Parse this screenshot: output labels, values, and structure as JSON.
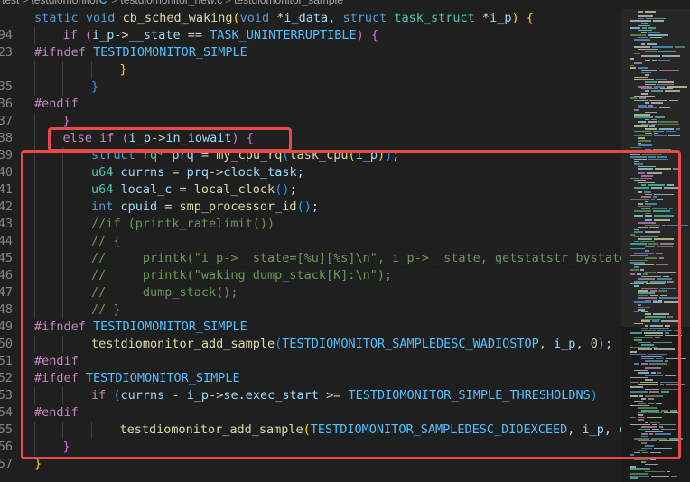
{
  "breadcrumb": {
    "parts": [
      "test",
      "testdiomonitor",
      "C",
      "testdiomonitor_new.c",
      "testdiomonitor_sample"
    ],
    "separator": ">"
  },
  "code_lines": [
    {
      "ln": "",
      "indent": 0,
      "tokens": [
        [
          "kw",
          "static"
        ],
        [
          "op",
          " "
        ],
        [
          "kw",
          "void"
        ],
        [
          "op",
          " "
        ],
        [
          "fn",
          "cb_sched_waking"
        ],
        [
          "br1",
          "("
        ],
        [
          "kw",
          "void"
        ],
        [
          "op",
          " *"
        ],
        [
          "var",
          "i_data"
        ],
        [
          "op",
          ", "
        ],
        [
          "kw",
          "struct"
        ],
        [
          "op",
          " "
        ],
        [
          "ty",
          "task_struct"
        ],
        [
          "op",
          " *"
        ],
        [
          "var",
          "i_p"
        ],
        [
          "br1",
          ")"
        ],
        [
          "op",
          " "
        ],
        [
          "br1",
          "{"
        ]
      ]
    },
    {
      "ln": "94",
      "indent": 1,
      "tokens": [
        [
          "pre",
          "if"
        ],
        [
          "op",
          " "
        ],
        [
          "br2",
          "("
        ],
        [
          "var",
          "i_p"
        ],
        [
          "op",
          "->"
        ],
        [
          "var",
          "__state"
        ],
        [
          "op",
          " == "
        ],
        [
          "mac",
          "TASK_UNINTERRUPTIBLE"
        ],
        [
          "br2",
          ")"
        ],
        [
          "op",
          " "
        ],
        [
          "br2",
          "{"
        ]
      ]
    },
    {
      "ln": "23",
      "indent": 0,
      "tokens": [
        [
          "pre",
          "#ifndef"
        ],
        [
          "op",
          " "
        ],
        [
          "mac",
          "TESTDIOMONITOR_SIMPLE"
        ]
      ]
    },
    {
      "ln": "",
      "indent": 3,
      "tokens": [
        [
          "br1",
          "}"
        ]
      ]
    },
    {
      "ln": "35",
      "indent": 2,
      "tokens": [
        [
          "br3",
          "}"
        ]
      ]
    },
    {
      "ln": "36",
      "indent": 0,
      "tokens": [
        [
          "pre",
          "#endif"
        ]
      ]
    },
    {
      "ln": "37",
      "indent": 1,
      "tokens": [
        [
          "br2",
          "}"
        ]
      ]
    },
    {
      "ln": "38",
      "indent": 1,
      "tokens": [
        [
          "pre",
          "else"
        ],
        [
          "op",
          " "
        ],
        [
          "pre",
          "if"
        ],
        [
          "op",
          " "
        ],
        [
          "br2",
          "("
        ],
        [
          "var",
          "i_p"
        ],
        [
          "op",
          "->"
        ],
        [
          "var",
          "in_iowait"
        ],
        [
          "br2",
          ")"
        ],
        [
          "op",
          " "
        ],
        [
          "br2",
          "{"
        ]
      ]
    },
    {
      "ln": "39",
      "indent": 2,
      "tokens": [
        [
          "kw",
          "struct"
        ],
        [
          "op",
          " "
        ],
        [
          "ty",
          "rq"
        ],
        [
          "op",
          "* "
        ],
        [
          "var",
          "prq"
        ],
        [
          "op",
          " = "
        ],
        [
          "fn",
          "my_cpu_rq"
        ],
        [
          "br3",
          "("
        ],
        [
          "fn",
          "task_cpu"
        ],
        [
          "br1",
          "("
        ],
        [
          "var",
          "i_p"
        ],
        [
          "br1",
          ")"
        ],
        [
          "br3",
          ")"
        ],
        [
          "op",
          ";"
        ]
      ]
    },
    {
      "ln": "40",
      "indent": 2,
      "tokens": [
        [
          "ty",
          "u64"
        ],
        [
          "op",
          " "
        ],
        [
          "var",
          "currns"
        ],
        [
          "op",
          " = "
        ],
        [
          "var",
          "prq"
        ],
        [
          "op",
          "->"
        ],
        [
          "var",
          "clock_task"
        ],
        [
          "op",
          ";"
        ]
      ]
    },
    {
      "ln": "41",
      "indent": 2,
      "tokens": [
        [
          "ty",
          "u64"
        ],
        [
          "op",
          " "
        ],
        [
          "var",
          "local_c"
        ],
        [
          "op",
          " = "
        ],
        [
          "fn",
          "local_clock"
        ],
        [
          "br3",
          "()"
        ],
        [
          "op",
          ";"
        ]
      ]
    },
    {
      "ln": "42",
      "indent": 2,
      "tokens": [
        [
          "kw",
          "int"
        ],
        [
          "op",
          " "
        ],
        [
          "var",
          "cpuid"
        ],
        [
          "op",
          " = "
        ],
        [
          "fn",
          "smp_processor_id"
        ],
        [
          "br3",
          "()"
        ],
        [
          "op",
          ";"
        ]
      ]
    },
    {
      "ln": "43",
      "indent": 2,
      "tokens": [
        [
          "cm",
          "//if (printk_ratelimit())"
        ]
      ]
    },
    {
      "ln": "44",
      "indent": 2,
      "tokens": [
        [
          "cm",
          "// {"
        ]
      ]
    },
    {
      "ln": "45",
      "indent": 2,
      "tokens": [
        [
          "cm",
          "//     printk(\"i_p->__state=[%u][%s]\\n\", i_p->__state, getstatstr_bystate(i_p->__state));"
        ]
      ]
    },
    {
      "ln": "46",
      "indent": 2,
      "tokens": [
        [
          "cm",
          "//     printk(\"waking dump_stack[K]:\\n\");"
        ]
      ]
    },
    {
      "ln": "47",
      "indent": 2,
      "tokens": [
        [
          "cm",
          "//     dump_stack();"
        ]
      ]
    },
    {
      "ln": "48",
      "indent": 2,
      "tokens": [
        [
          "cm",
          "// }"
        ]
      ]
    },
    {
      "ln": "49",
      "indent": 0,
      "tokens": [
        [
          "pre",
          "#ifndef"
        ],
        [
          "op",
          " "
        ],
        [
          "mac",
          "TESTDIOMONITOR_SIMPLE"
        ]
      ]
    },
    {
      "ln": "50",
      "indent": 2,
      "tokens": [
        [
          "fn",
          "testdiomonitor_add_sample"
        ],
        [
          "br3",
          "("
        ],
        [
          "mac",
          "TESTDIOMONITOR_SAMPLEDESC_WADIOSTOP"
        ],
        [
          "op",
          ", "
        ],
        [
          "var",
          "i_p"
        ],
        [
          "op",
          ", "
        ],
        [
          "num",
          "0"
        ],
        [
          "br3",
          ")"
        ],
        [
          "op",
          ";"
        ]
      ]
    },
    {
      "ln": "51",
      "indent": 0,
      "tokens": [
        [
          "pre",
          "#endif"
        ]
      ]
    },
    {
      "ln": "52",
      "indent": 0,
      "tokens": [
        [
          "pre",
          "#ifdef"
        ],
        [
          "op",
          " "
        ],
        [
          "mac",
          "TESTDIOMONITOR_SIMPLE"
        ]
      ]
    },
    {
      "ln": "53",
      "indent": 2,
      "tokens": [
        [
          "pre",
          "if"
        ],
        [
          "op",
          " "
        ],
        [
          "br3",
          "("
        ],
        [
          "var",
          "currns"
        ],
        [
          "op",
          " - "
        ],
        [
          "var",
          "i_p"
        ],
        [
          "op",
          "->"
        ],
        [
          "var",
          "se"
        ],
        [
          "op",
          "."
        ],
        [
          "var",
          "exec_start"
        ],
        [
          "op",
          " >= "
        ],
        [
          "mac",
          "TESTDIOMONITOR_SIMPLE_THRESHOLDNS"
        ],
        [
          "br3",
          ")"
        ]
      ]
    },
    {
      "ln": "54",
      "indent": 0,
      "tokens": [
        [
          "pre",
          "#endif"
        ]
      ]
    },
    {
      "ln": "55",
      "indent": 3,
      "tokens": [
        [
          "fn",
          "testdiomonitor_add_sample"
        ],
        [
          "br1",
          "("
        ],
        [
          "mac",
          "TESTDIOMONITOR_SAMPLEDESC_DIOEXCEED"
        ],
        [
          "op",
          ", "
        ],
        [
          "var",
          "i_p"
        ],
        [
          "op",
          ", "
        ],
        [
          "var",
          "currns"
        ],
        [
          "op",
          " - "
        ],
        [
          "var",
          "i_p"
        ],
        [
          "op",
          "->"
        ],
        [
          "var",
          "se"
        ],
        [
          "op",
          "."
        ],
        [
          "var",
          "exec_start"
        ],
        [
          "br1",
          ")"
        ],
        [
          "op",
          ";"
        ]
      ]
    },
    {
      "ln": "56",
      "indent": 1,
      "tokens": [
        [
          "br2",
          "}"
        ]
      ]
    },
    {
      "ln": "57",
      "indent": 0,
      "tokens": [
        [
          "br1",
          "}"
        ]
      ]
    }
  ],
  "colors": {
    "background": "#1f1f1f",
    "highlight_box": "#e84a4a",
    "keyword": "#569cd6",
    "type": "#4ec9b0",
    "function": "#dcdcaa",
    "variable": "#9cdcfe",
    "macro": "#4fc1ff",
    "comment": "#6a9955",
    "preprocessor": "#c586c0"
  }
}
